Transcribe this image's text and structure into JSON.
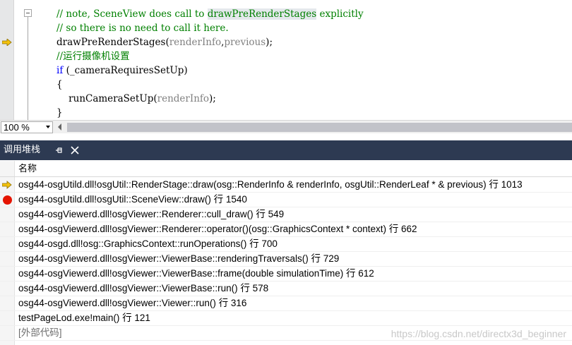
{
  "editor": {
    "lines": [
      {
        "segments": [
          {
            "text": "// note, SceneView does call to ",
            "cls": "cmt"
          },
          {
            "text": "drawPreRenderStages",
            "cls": "cmt hl"
          },
          {
            "text": " explicitly",
            "cls": "cmt"
          }
        ]
      },
      {
        "segments": [
          {
            "text": "// so there is no need to call it here.",
            "cls": "cmt"
          }
        ]
      },
      {
        "segments": [
          {
            "text": "drawPreRenderStages(",
            "cls": ""
          },
          {
            "text": "renderInfo",
            "cls": "param"
          },
          {
            "text": ",",
            "cls": ""
          },
          {
            "text": "previous",
            "cls": "param"
          },
          {
            "text": ");",
            "cls": ""
          }
        ]
      },
      {
        "segments": [
          {
            "text": "//运行摄像机设置",
            "cls": "cmt"
          }
        ]
      },
      {
        "segments": [
          {
            "text": "if",
            "cls": "kw"
          },
          {
            "text": " (_cameraRequiresSetUp)",
            "cls": ""
          }
        ]
      },
      {
        "segments": [
          {
            "text": "{",
            "cls": ""
          }
        ]
      },
      {
        "segments": [
          {
            "text": "    runCameraSetUp(",
            "cls": ""
          },
          {
            "text": "renderInfo",
            "cls": "param"
          },
          {
            "text": ");",
            "cls": ""
          }
        ]
      },
      {
        "segments": [
          {
            "text": "}",
            "cls": ""
          }
        ]
      }
    ],
    "current_line_index": 2,
    "arrow_color": "#f4c20d"
  },
  "zoom": {
    "value": "100 %"
  },
  "panel": {
    "title": "调用堆栈",
    "column_header": "名称",
    "header_bg": "#2d3a52",
    "frames": [
      {
        "text": "osg44-osgUtild.dll!osgUtil::RenderStage::draw(osg::RenderInfo & renderInfo, osgUtil::RenderLeaf * & previous) 行 1013",
        "marker": "current"
      },
      {
        "text": "osg44-osgUtild.dll!osgUtil::SceneView::draw() 行 1540",
        "marker": "breakpoint"
      },
      {
        "text": "osg44-osgViewerd.dll!osgViewer::Renderer::cull_draw() 行 549",
        "marker": ""
      },
      {
        "text": "osg44-osgViewerd.dll!osgViewer::Renderer::operator()(osg::GraphicsContext * context) 行 662",
        "marker": ""
      },
      {
        "text": "osg44-osgd.dll!osg::GraphicsContext::runOperations() 行 700",
        "marker": ""
      },
      {
        "text": "osg44-osgViewerd.dll!osgViewer::ViewerBase::renderingTraversals() 行 729",
        "marker": ""
      },
      {
        "text": "osg44-osgViewerd.dll!osgViewer::ViewerBase::frame(double simulationTime) 行 612",
        "marker": ""
      },
      {
        "text": "osg44-osgViewerd.dll!osgViewer::ViewerBase::run() 行 578",
        "marker": ""
      },
      {
        "text": "osg44-osgViewerd.dll!osgViewer::Viewer::run() 行 316",
        "marker": ""
      },
      {
        "text": "testPageLod.exe!main() 行 121",
        "marker": ""
      },
      {
        "text": "[外部代码]",
        "marker": "external"
      }
    ]
  },
  "watermark": "https://blog.csdn.net/directx3d_beginner"
}
